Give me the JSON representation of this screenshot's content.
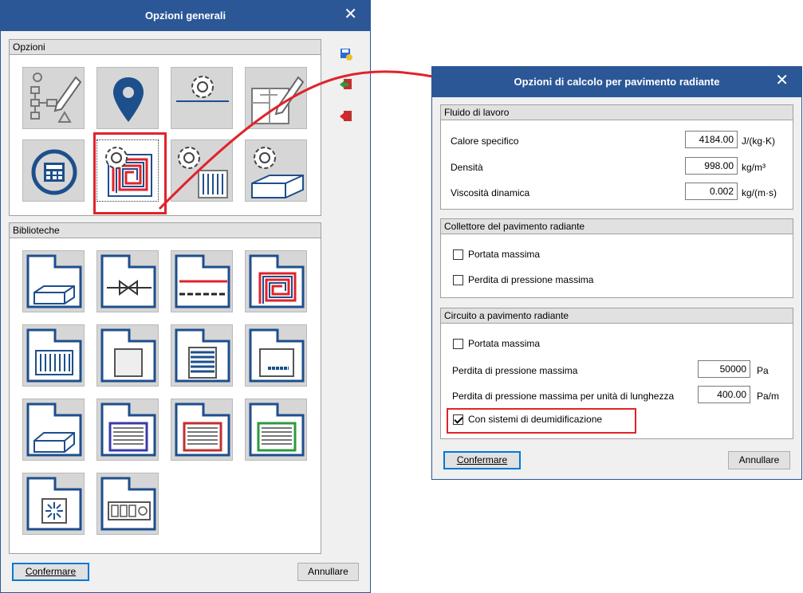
{
  "left_dialog": {
    "title": "Opzioni generali",
    "close": "✕",
    "options_group": "Opzioni",
    "libraries_group": "Biblioteche",
    "confirm": "Confermare",
    "cancel": "Annullare"
  },
  "right_dialog": {
    "title": "Opzioni di calcolo per pavimento radiante",
    "close": "✕",
    "fluid": {
      "header": "Fluido di lavoro",
      "rows": [
        {
          "label": "Calore specifico",
          "value": "4184.00",
          "unit": "J/(kg·K)"
        },
        {
          "label": "Densità",
          "value": "998.00",
          "unit": "kg/m³"
        },
        {
          "label": "Viscosità dinamica",
          "value": "0.002",
          "unit": "kg/(m·s)"
        }
      ]
    },
    "collector": {
      "header": "Collettore del pavimento radiante",
      "max_flow": "Portata massima",
      "max_pressure_loss": "Perdita di pressione massima"
    },
    "circuit": {
      "header": "Circuito a pavimento radiante",
      "max_flow": "Portata massima",
      "pressure_loss_label": "Perdita di pressione massima",
      "pressure_loss_value": "50000",
      "pressure_loss_unit": "Pa",
      "pressure_per_length_label": "Perdita di pressione massima per unità di lunghezza",
      "pressure_per_length_value": "400.00",
      "pressure_per_length_unit": "Pa/m",
      "dehumid_label": "Con sistemi di deumidificazione",
      "dehumid_checked": true
    },
    "confirm": "Confermare",
    "cancel": "Annullare"
  },
  "colors": {
    "titlebar": "#2b5797",
    "highlight": "#e0232b",
    "icon_blue": "#1d4f8c"
  }
}
